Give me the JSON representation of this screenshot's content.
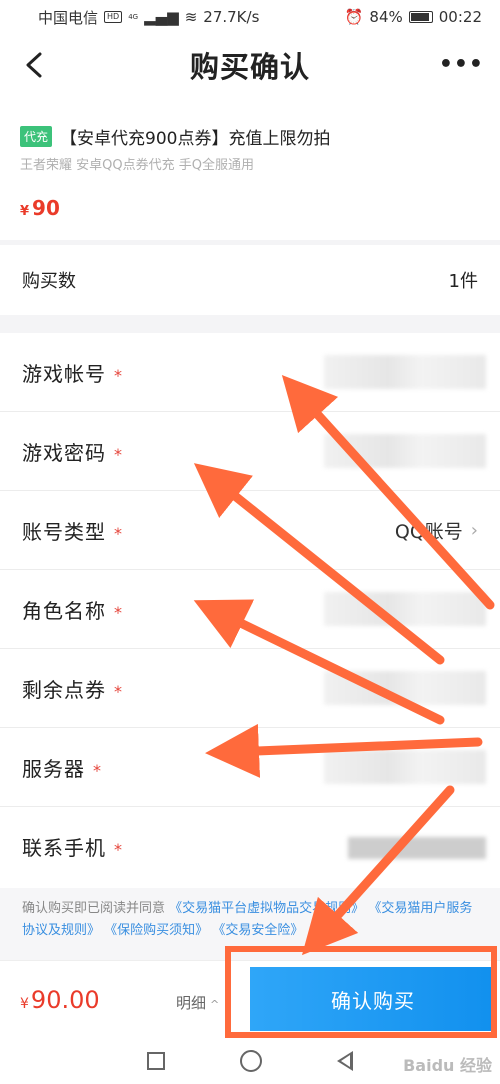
{
  "status_bar": {
    "carrier": "中国电信",
    "hd": "HD",
    "signal": "4G",
    "speed": "27.7K/s",
    "battery": "84%",
    "time": "00:22"
  },
  "header": {
    "title": "购买确认",
    "back_icon": "chevron-left-icon",
    "more_icon": "more-dots-icon"
  },
  "product": {
    "badge": "代充",
    "title": "【安卓代充900点券】充值上限勿拍",
    "subtitle": "王者荣耀 安卓QQ点券代充 手Q全服通用",
    "currency": "¥",
    "price": "90"
  },
  "quantity": {
    "label": "购买数",
    "value": "1件"
  },
  "form": {
    "fields": [
      {
        "label": "游戏帐号",
        "required": "*",
        "value": ""
      },
      {
        "label": "游戏密码",
        "required": "*",
        "value": ""
      },
      {
        "label": "账号类型",
        "required": "*",
        "value": "QQ账号"
      },
      {
        "label": "角色名称",
        "required": "*",
        "value": ""
      },
      {
        "label": "剩余点券",
        "required": "*",
        "value": ""
      },
      {
        "label": "服务器",
        "required": "*",
        "value": ""
      },
      {
        "label": "联系手机",
        "required": "*",
        "value": ""
      }
    ]
  },
  "agreement": {
    "prefix": "确认购买即已阅读并同意",
    "links": [
      "《交易猫平台虚拟物品交易规则》",
      "《交易猫用户服务协议及规则》",
      "《保险购买须知》",
      "《交易安全险》"
    ]
  },
  "bottom_bar": {
    "currency": "¥",
    "total": "90.00",
    "detail_label": "明细",
    "buy_label": "确认购买"
  },
  "watermark": "Baidu 经验",
  "colors": {
    "accent_blue": "#1190ee",
    "price_red": "#ea3b2a",
    "annotation_orange": "#ff6a3c",
    "badge_green": "#3cc27a"
  }
}
